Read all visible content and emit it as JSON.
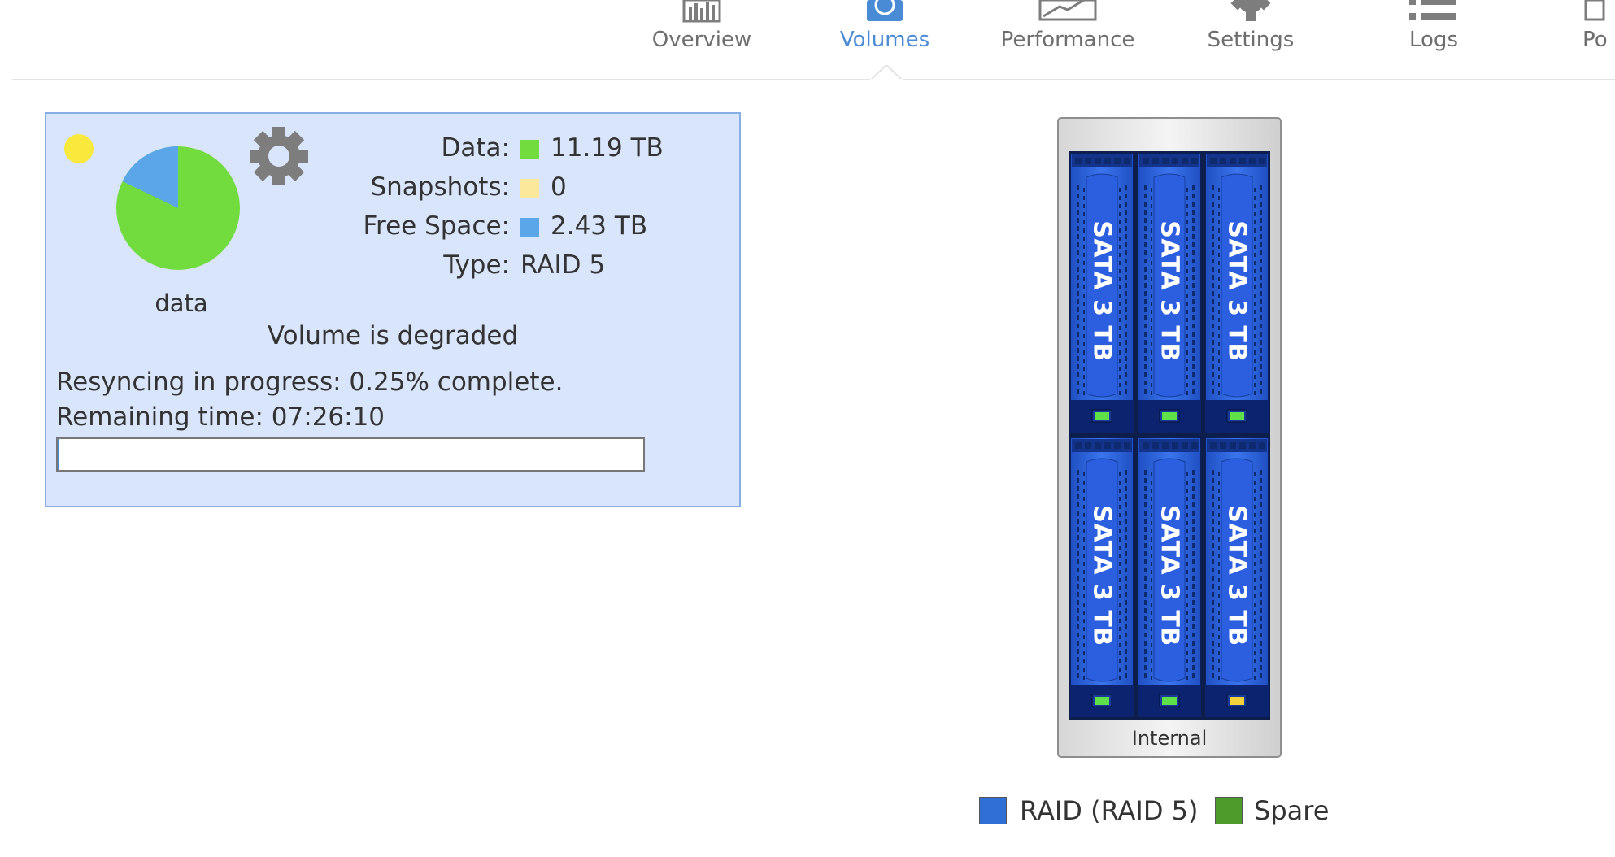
{
  "nav": {
    "items": [
      {
        "label": "Overview",
        "icon": "bar-chart-icon"
      },
      {
        "label": "Volumes",
        "icon": "volumes-icon",
        "active": true
      },
      {
        "label": "Performance",
        "icon": "performance-icon"
      },
      {
        "label": "Settings",
        "icon": "gear-icon"
      },
      {
        "label": "Logs",
        "icon": "list-icon"
      },
      {
        "label": "Po",
        "icon": "power-icon"
      }
    ],
    "accent_color": "#4a8bd6"
  },
  "volume": {
    "name": "data",
    "status_color": "#f8e93c",
    "pie_colors": {
      "data": "#72dc3f",
      "free": "#5aa6e8"
    },
    "stats": {
      "data": {
        "label": "Data:",
        "value": "11.19 TB",
        "color": "#72dc3f"
      },
      "snapshots": {
        "label": "Snapshots:",
        "value": "0",
        "color": "#fbe89a"
      },
      "free": {
        "label": "Free Space:",
        "value": "2.43 TB",
        "color": "#5aa6e8"
      },
      "type": {
        "label": "Type:",
        "value": "RAID 5"
      }
    },
    "degraded_text": "Volume is degraded",
    "resync_text": "Resyncing in progress: 0.25% complete.",
    "remaining_text": "Remaining time: 07:26:10",
    "progress_fraction": 0.0025
  },
  "enclosure": {
    "label": "Internal",
    "disks": [
      {
        "label": "SATA 3 TB",
        "led": "green"
      },
      {
        "label": "SATA 3 TB",
        "led": "green"
      },
      {
        "label": "SATA 3 TB",
        "led": "green"
      },
      {
        "label": "SATA 3 TB",
        "led": "green"
      },
      {
        "label": "SATA 3 TB",
        "led": "green"
      },
      {
        "label": "SATA 3 TB",
        "led": "yellow"
      }
    ]
  },
  "legend": [
    {
      "label": "RAID (RAID 5)",
      "color": "#2f6fd6"
    },
    {
      "label": "Spare",
      "color": "#4e9a2a"
    }
  ]
}
